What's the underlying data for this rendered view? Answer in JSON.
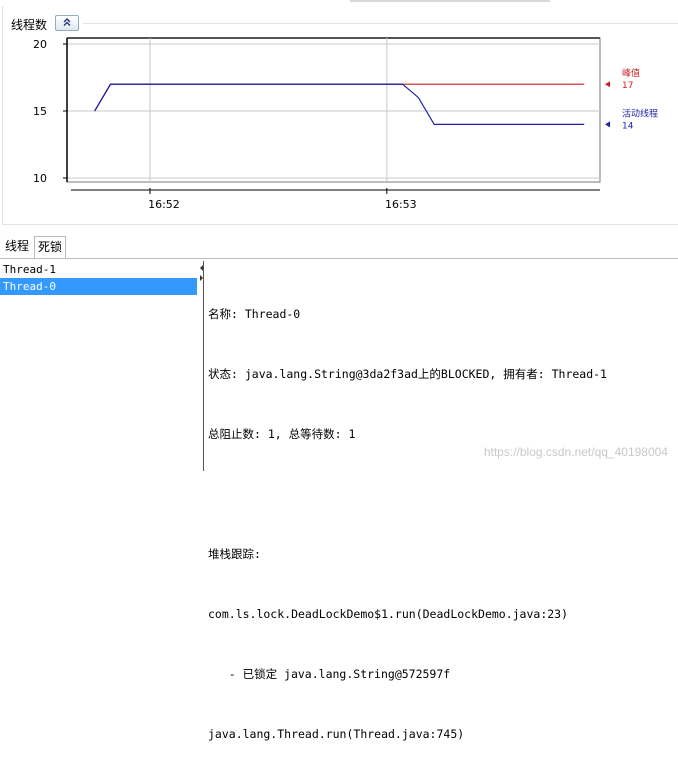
{
  "chart": {
    "title": "线程数",
    "collapse_icon": "double-chevron-up-icon",
    "colors": {
      "peak": "#cc2020",
      "live": "#1f1fa8"
    }
  },
  "chart_data": {
    "type": "line",
    "x_ticks": [
      "16:52",
      "16:53"
    ],
    "y_ticks": [
      10,
      15,
      20
    ],
    "ylim": [
      10,
      20
    ],
    "x": [
      "16:51:46",
      "16:51:50",
      "16:52:00",
      "16:52:30",
      "16:53:00",
      "16:53:04",
      "16:53:08",
      "16:53:12",
      "16:53:30",
      "16:53:50"
    ],
    "series": [
      {
        "name": "峰值",
        "current": "17",
        "values": [
          15,
          17,
          17,
          17,
          17,
          17,
          17,
          17,
          17,
          17
        ]
      },
      {
        "name": "活动线程",
        "current": "14",
        "values": [
          15,
          17,
          17,
          17,
          17,
          17,
          16,
          14,
          14,
          14
        ]
      }
    ]
  },
  "tabs": [
    {
      "label": "线程"
    },
    {
      "label": "死锁"
    }
  ],
  "threads": [
    {
      "label": "Thread-1"
    },
    {
      "label": "Thread-0"
    }
  ],
  "detail": {
    "lines": [
      "名称: Thread-0",
      "状态: java.lang.String@3da2f3ad上的BLOCKED, 拥有者: Thread-1",
      "总阻止数: 1, 总等待数: 1",
      "",
      "堆栈跟踪:",
      "com.ls.lock.DeadLockDemo$1.run(DeadLockDemo.java:23)",
      "   - 已锁定 java.lang.String@572597f",
      "java.lang.Thread.run(Thread.java:745)"
    ]
  },
  "watermark": "https://blog.csdn.net/qq_40198004"
}
